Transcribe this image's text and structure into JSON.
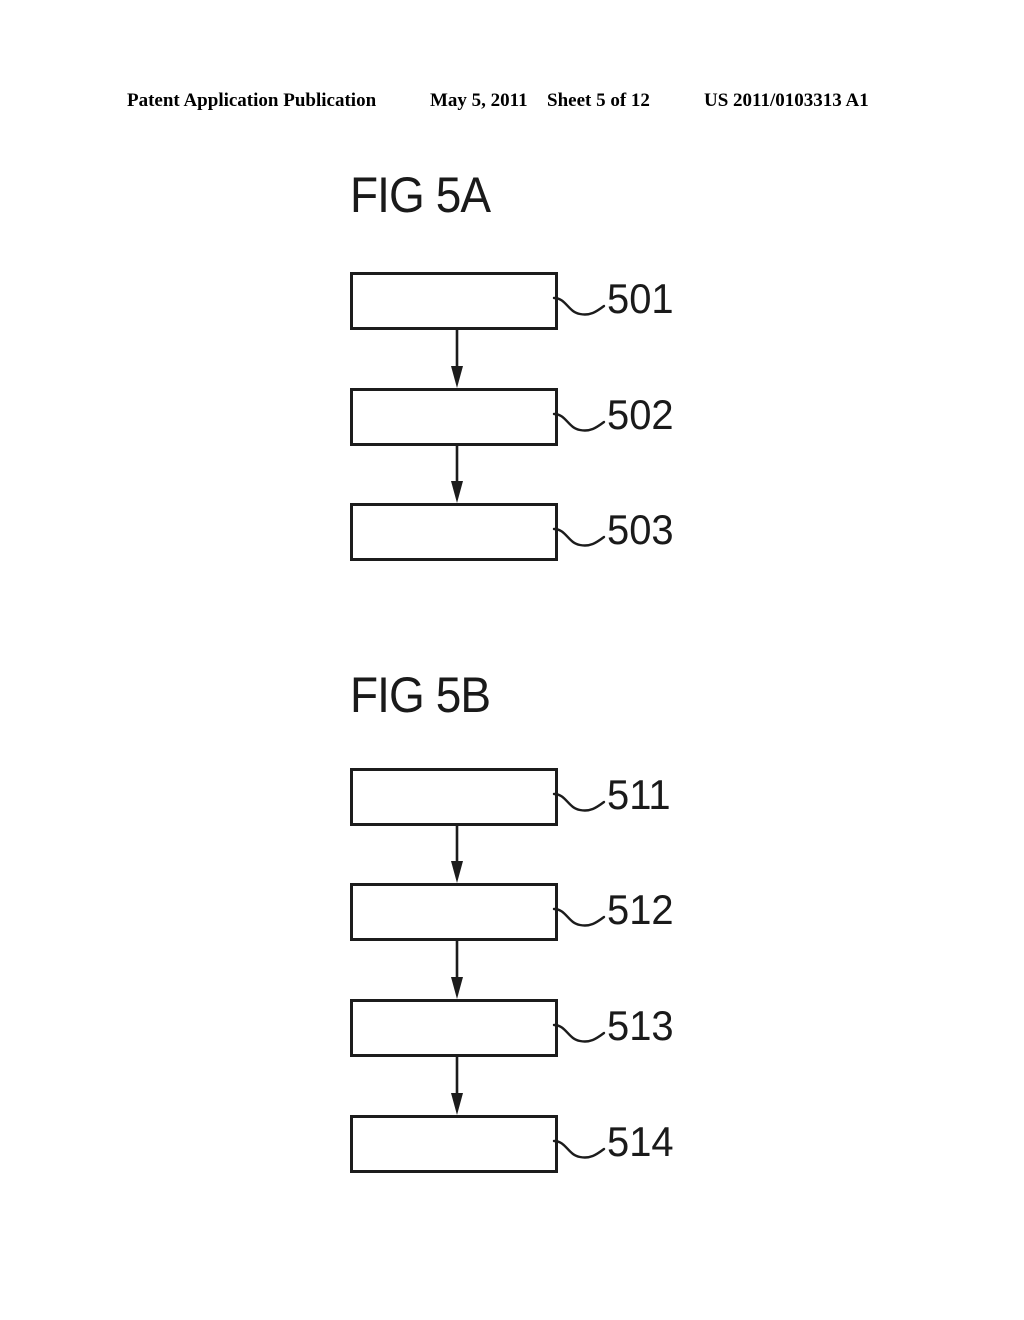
{
  "header": {
    "publication": "Patent Application Publication",
    "date": "May 5, 2011",
    "sheet": "Sheet 5 of 12",
    "number": "US 2011/0103313 A1"
  },
  "colors": {
    "ink": "#1c1c1c",
    "paper": "#ffffff"
  },
  "figures": [
    {
      "id": "figure-5a",
      "title": "FIG 5A",
      "steps": [
        {
          "ref": "501"
        },
        {
          "ref": "502"
        },
        {
          "ref": "503"
        }
      ]
    },
    {
      "id": "figure-5b",
      "title": "FIG 5B",
      "steps": [
        {
          "ref": "511"
        },
        {
          "ref": "512"
        },
        {
          "ref": "513"
        },
        {
          "ref": "514"
        }
      ]
    }
  ]
}
